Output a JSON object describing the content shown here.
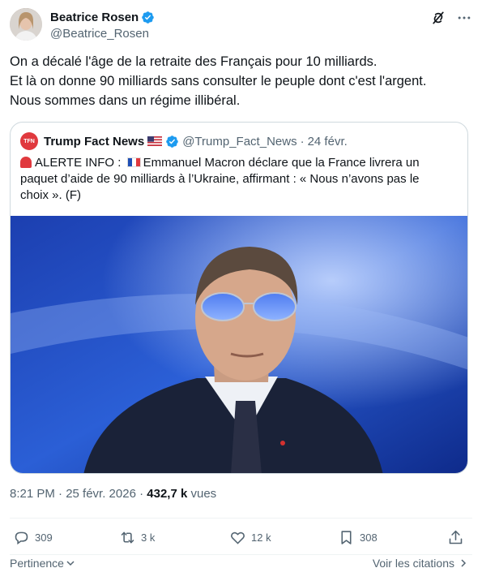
{
  "author": {
    "name": "Beatrice Rosen",
    "handle": "@Beatrice_Rosen"
  },
  "tweet": {
    "lines": [
      "On a décalé l'âge de la retraite des Français pour 10 milliards.",
      "Et là on donne 90 milliards sans consulter le peuple dont c'est l'argent.",
      "Nous sommes dans un régime illibéral."
    ]
  },
  "quote": {
    "avatar_text": "TFN",
    "name": "Trump Fact News",
    "handle": "@Trump_Fact_News",
    "separator": "·",
    "date": "24 févr.",
    "line1_prefix": "ALERTE INFO :",
    "line1_rest": "Emmanuel Macron déclare que la France livrera un",
    "line2": "paquet d’aide de 90 milliards à l’Ukraine, affirmant : « Nous n’avons pas le",
    "line3": "choix ». (F)"
  },
  "meta": {
    "time": "8:21 PM · 25 févr. 2026 · ",
    "views_count": "432,7 k",
    "views_label": " vues"
  },
  "actions": {
    "replies": "309",
    "retweets": "3 k",
    "likes": "12 k",
    "bookmarks": "308"
  },
  "footer": {
    "sort_label": "Pertinence",
    "quotes_link": "Voir les citations"
  },
  "colors": {
    "text": "#0f1419",
    "muted": "#536471",
    "verified": "#1d9bf0",
    "border": "#cfd9de"
  },
  "icons": [
    "verified-badge-icon",
    "grok-icon",
    "more-icon",
    "siren-icon",
    "us-flag-icon",
    "fr-flag-icon",
    "reply-icon",
    "retweet-icon",
    "like-icon",
    "bookmark-icon",
    "share-icon",
    "chevron-down-icon",
    "chevron-right-icon"
  ]
}
